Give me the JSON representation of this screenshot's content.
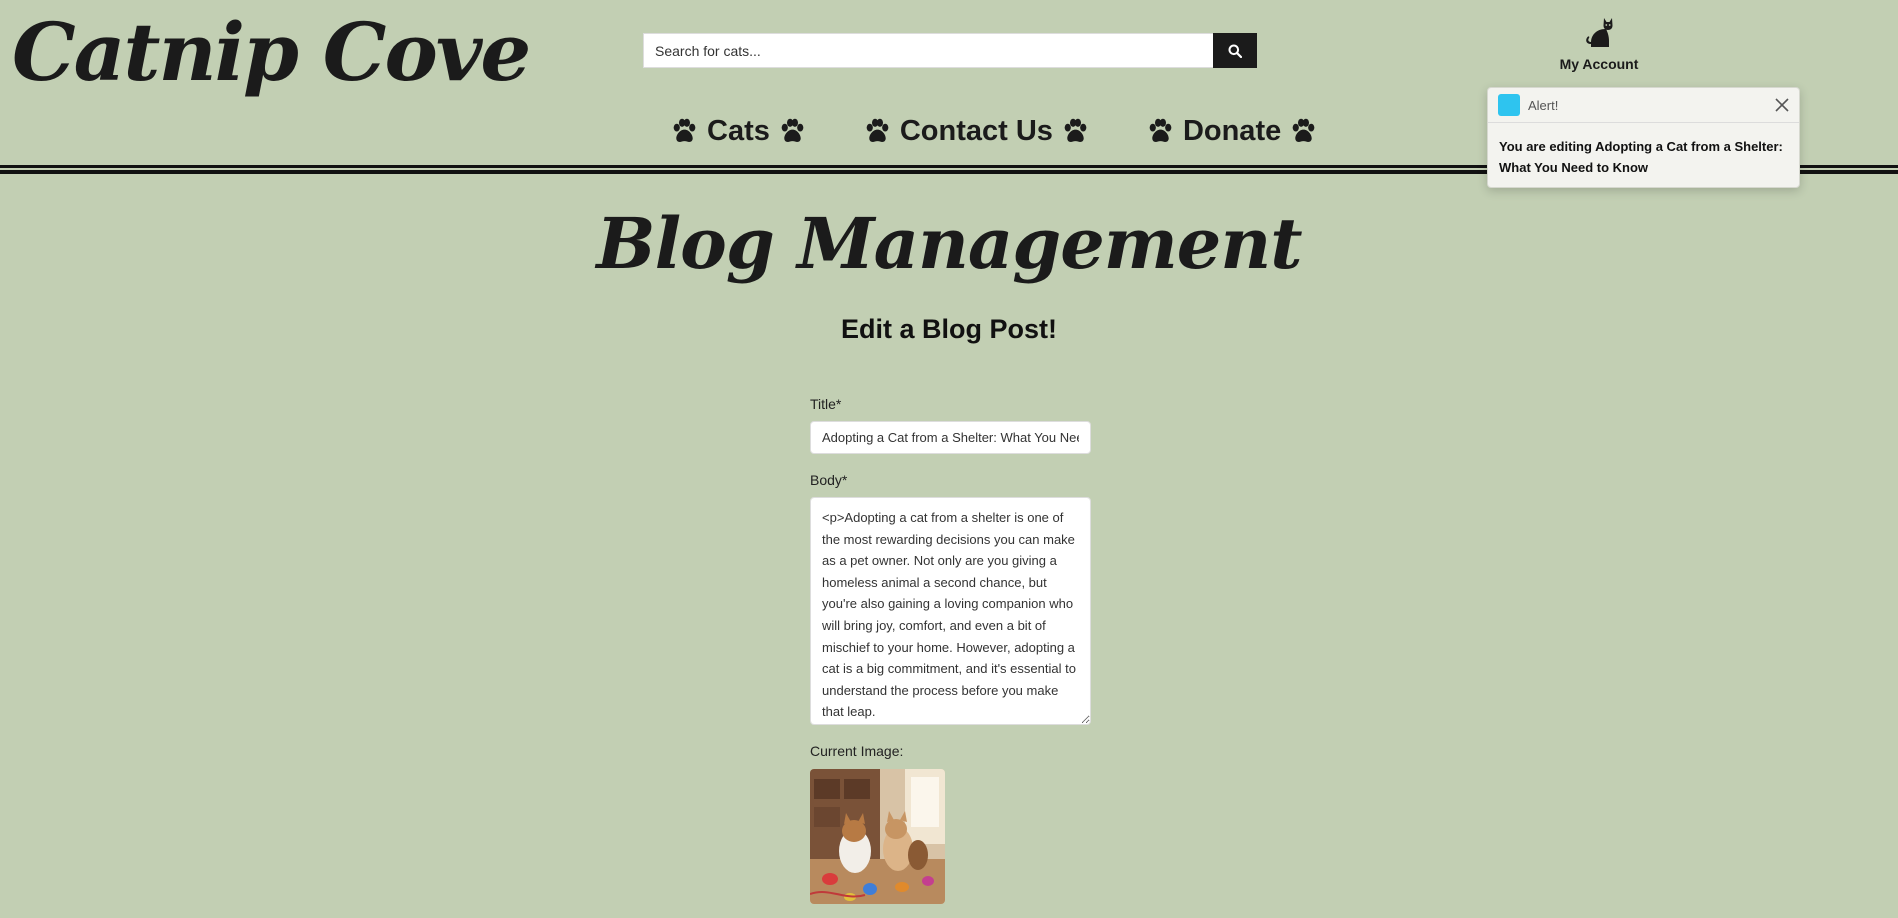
{
  "header": {
    "logo": "Catnip Cove",
    "search": {
      "placeholder": "Search for cats...",
      "value": ""
    },
    "account": {
      "label": "My Account",
      "icon": "cat-icon"
    },
    "nav": [
      {
        "label": "Cats",
        "icon": "paw-icon"
      },
      {
        "label": "Contact Us",
        "icon": "paw-icon"
      },
      {
        "label": "Donate",
        "icon": "paw-icon"
      }
    ]
  },
  "alert": {
    "title": "Alert!",
    "message": "You are editing Adopting a Cat from a Shelter: What You Need to Know",
    "swatch_color": "#2ec4ef"
  },
  "main": {
    "title": "Blog Management",
    "subtitle": "Edit a Blog Post!",
    "form": {
      "title_label": "Title*",
      "title_value": "Adopting a Cat from a Shelter: What You Need to Know",
      "body_label": "Body*",
      "body_value": "<p>Adopting a cat from a shelter is one of the most rewarding decisions you can make as a pet owner. Not only are you giving a homeless animal a second chance, but you're also gaining a loving companion who will bring joy, comfort, and even a bit of mischief to your home. However, adopting a cat is a big commitment, and it's essential to understand the process before you make that leap.",
      "image_label": "Current Image:"
    }
  },
  "colors": {
    "background": "#c2cfb3",
    "text": "#1b1b1b",
    "search_button": "#1b1b1b"
  }
}
